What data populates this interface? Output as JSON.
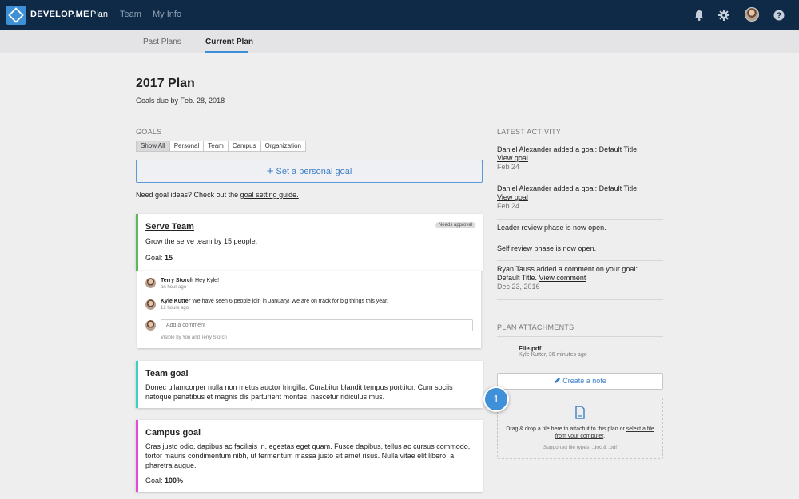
{
  "brand": {
    "name": "DEVELOP.ME"
  },
  "nav": {
    "items": [
      {
        "label": "Plan"
      },
      {
        "label": "Team"
      },
      {
        "label": "My Info"
      }
    ]
  },
  "subnav": {
    "tabs": [
      {
        "label": "Past Plans"
      },
      {
        "label": "Current Plan"
      }
    ]
  },
  "plan": {
    "title": "2017 Plan",
    "subtitle": "Goals due by Feb. 28, 2018"
  },
  "goals_section": {
    "label": "GOALS",
    "filters": [
      "Show All",
      "Personal",
      "Team",
      "Campus",
      "Organization"
    ],
    "set_goal_label": "Set a personal goal",
    "ideas_text": "Need goal ideas? Check out the ",
    "ideas_link": "goal setting guide."
  },
  "goals": [
    {
      "title": "Serve Team",
      "badge": "Needs approval",
      "description": "Grow the serve team by 15 people.",
      "metric_label": "Goal: ",
      "metric_value": "15",
      "color": "#5cb85c"
    },
    {
      "title": "Team goal",
      "description": "Donec ullamcorper nulla non metus auctor fringilla. Curabitur blandit tempus porttitor. Cum sociis natoque penatibus et magnis dis parturient montes, nascetur ridiculus mus.",
      "color": "#3ccfc4"
    },
    {
      "title": "Campus goal",
      "description": "Cras justo odio, dapibus ac facilisis in, egestas eget quam. Fusce dapibus, tellus ac cursus commodo, tortor mauris condimentum nibh, ut fermentum massa justo sit amet risus. Nulla vitae elit libero, a pharetra augue.",
      "metric_label": "Goal: ",
      "metric_value": "100%",
      "color": "#e04bd8"
    }
  ],
  "comments": {
    "items": [
      {
        "author": "Terry Storch",
        "text": " Hey Kyle!",
        "time": "an hour ago"
      },
      {
        "author": "Kyle Kutter",
        "text": " We have seen 6 people join in January! We are on track for big things this year.",
        "time": "12 hours ago"
      }
    ],
    "input_placeholder": "Add a comment",
    "visibility": "Visible by You and Terry Storch"
  },
  "activity": {
    "label": "LATEST ACTIVITY",
    "items": [
      {
        "text": "Daniel Alexander added a goal: Default Title.",
        "link": "View goal",
        "date": "Feb 24"
      },
      {
        "text": "Daniel Alexander added a goal: Default Title.",
        "link": "View goal",
        "date": "Feb 24"
      },
      {
        "text": "Leader review phase is now open."
      },
      {
        "text": "Self review phase is now open."
      },
      {
        "text": "Ryan Tauss added a comment on your goal: Default Title. ",
        "link": "View comment",
        "date": "Dec 23, 2016"
      }
    ]
  },
  "attachments": {
    "label": "PLAN ATTACHMENTS",
    "file": {
      "name": "File.pdf",
      "meta": "Kyle Kutter, 36 minutes ago"
    },
    "note_label": "Create a note",
    "drop_text": "Drag & drop a file here to attach it to this plan or ",
    "drop_link": "select a file from your computer",
    "drop_end": ".",
    "drop_types": "Supported file types: .doc & .pdf"
  },
  "step_marker": "1",
  "colors": {
    "navbar": "#0e2a47",
    "accent": "#3d8fd6",
    "background": "#eeeeef"
  }
}
